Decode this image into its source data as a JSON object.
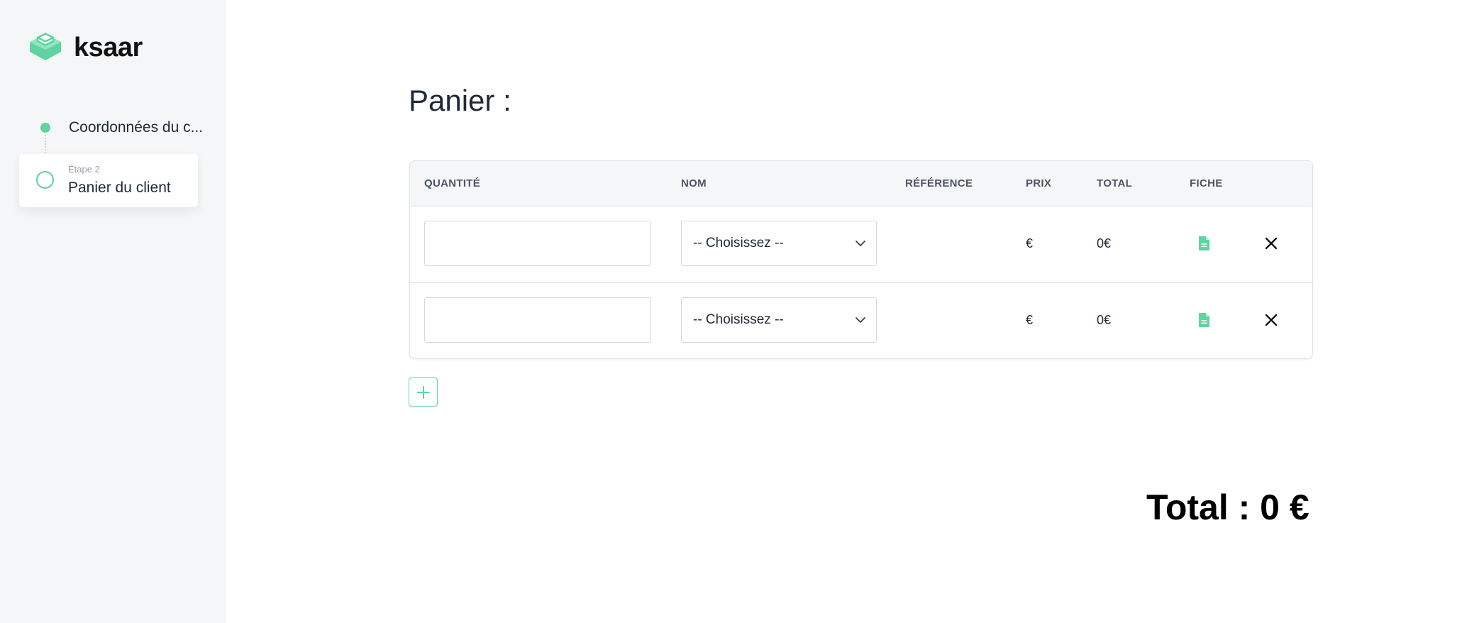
{
  "brand": {
    "name": "ksaar",
    "accent": "#5fd3a0"
  },
  "stepper": {
    "steps": [
      {
        "label": "Coordonnées du c...",
        "status": "completed"
      },
      {
        "kicker": "Étape 2",
        "label": "Panier du client",
        "status": "current"
      }
    ]
  },
  "main": {
    "title": "Panier :",
    "table": {
      "headers": {
        "quantite": "QUANTITÉ",
        "nom": "NOM",
        "reference": "RÉFÉRENCE",
        "prix": "PRIX",
        "total": "TOTAL",
        "fiche": "FICHE"
      },
      "rows": [
        {
          "quantity": "",
          "nom": "-- Choisissez --",
          "reference": "",
          "prix": "€",
          "total": "0€",
          "fiche_icon": "file-icon",
          "remove_icon": "close-icon"
        },
        {
          "quantity": "",
          "nom": "-- Choisissez --",
          "reference": "",
          "prix": "€",
          "total": "0€",
          "fiche_icon": "file-icon",
          "remove_icon": "close-icon"
        }
      ]
    },
    "add_icon": "plus-icon",
    "total": "Total : 0 €"
  }
}
